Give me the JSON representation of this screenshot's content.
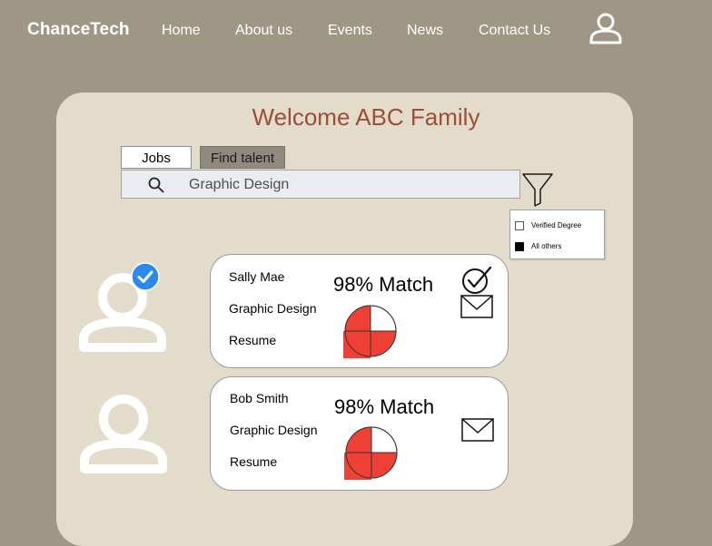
{
  "brand": "ChanceTech",
  "nav": {
    "home": "Home",
    "about": "About us",
    "events": "Events",
    "news": "News",
    "contact": "Contact Us"
  },
  "welcome": "Welcome ABC Family",
  "tabs": {
    "jobs": "Jobs",
    "find_talent": "Find talent"
  },
  "search": {
    "value": "Graphic Design"
  },
  "filters": [
    {
      "label": "Verified Degree",
      "checked": false
    },
    {
      "label": "All others",
      "checked": true
    }
  ],
  "candidates": [
    {
      "name": "Sally Mae",
      "role": "Graphic Design",
      "resume": "Resume",
      "match": "98% Match",
      "verified": true,
      "match_percent": 98
    },
    {
      "name": "Bob Smith",
      "role": "Graphic Design",
      "resume": "Resume",
      "match": "98% Match",
      "verified": false,
      "match_percent": 98
    }
  ],
  "colors": {
    "background": "#9f9786",
    "panel": "#e3dccb",
    "welcome_text": "#9b4e3a",
    "pie_fill": "#ee4035",
    "verified_badge": "#2a8af1"
  },
  "icons": {
    "profile": "user-icon",
    "search": "magnifier-icon",
    "filter": "funnel-icon",
    "verified": "check-badge-icon",
    "approve": "check-circle-icon",
    "message": "envelope-icon"
  }
}
